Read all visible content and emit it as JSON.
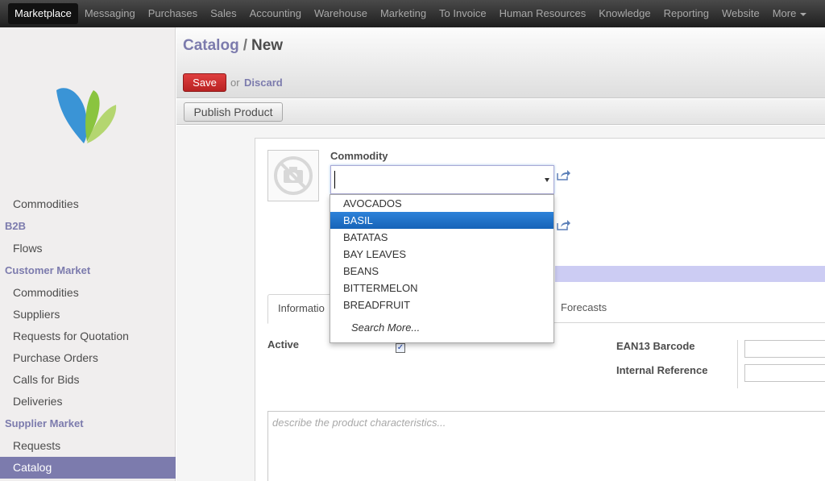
{
  "topmenu": {
    "items": [
      "Marketplace",
      "Messaging",
      "Purchases",
      "Sales",
      "Accounting",
      "Warehouse",
      "Marketing",
      "To Invoice",
      "Human Resources",
      "Knowledge",
      "Reporting",
      "Website",
      "More"
    ]
  },
  "sidebar": {
    "entries": [
      {
        "kind": "item",
        "label": "Commodities"
      },
      {
        "kind": "section",
        "label": "B2B"
      },
      {
        "kind": "item",
        "label": "Flows"
      },
      {
        "kind": "section",
        "label": "Customer Market"
      },
      {
        "kind": "item",
        "label": "Commodities"
      },
      {
        "kind": "item",
        "label": "Suppliers"
      },
      {
        "kind": "item",
        "label": "Requests for Quotation"
      },
      {
        "kind": "item",
        "label": "Purchase Orders"
      },
      {
        "kind": "item",
        "label": "Calls for Bids"
      },
      {
        "kind": "item",
        "label": "Deliveries"
      },
      {
        "kind": "section",
        "label": "Supplier Market"
      },
      {
        "kind": "item",
        "label": "Requests"
      },
      {
        "kind": "item",
        "label": "Catalog",
        "selected": true
      }
    ]
  },
  "header": {
    "breadcrumb_parent": "Catalog",
    "breadcrumb_sep": "/",
    "breadcrumb_current": "New",
    "save_label": "Save",
    "or_text": "or",
    "discard_label": "Discard",
    "publish_label": "Publish Product"
  },
  "form": {
    "commodity_label": "Commodity",
    "commodity_value": "",
    "tabs": [
      "Informatio",
      "Forecasts"
    ],
    "active_label": "Active",
    "active_checked": true,
    "ean13_label": "EAN13 Barcode",
    "internal_ref_label": "Internal Reference",
    "description_placeholder": "describe the product characteristics..."
  },
  "dropdown": {
    "options": [
      "AVOCADOS",
      "BASIL",
      "BATATAS",
      "BAY LEAVES",
      "BEANS",
      "BITTERMELON",
      "BREADFRUIT"
    ],
    "highlighted": "BASIL",
    "search_more": "Search More..."
  },
  "colors": {
    "accent": "#7c7bad",
    "save_red": "#c62929",
    "highlight_blue": "#1e6fc8",
    "logo_blue": "#3a94d6",
    "logo_green": "#8ac43f"
  }
}
